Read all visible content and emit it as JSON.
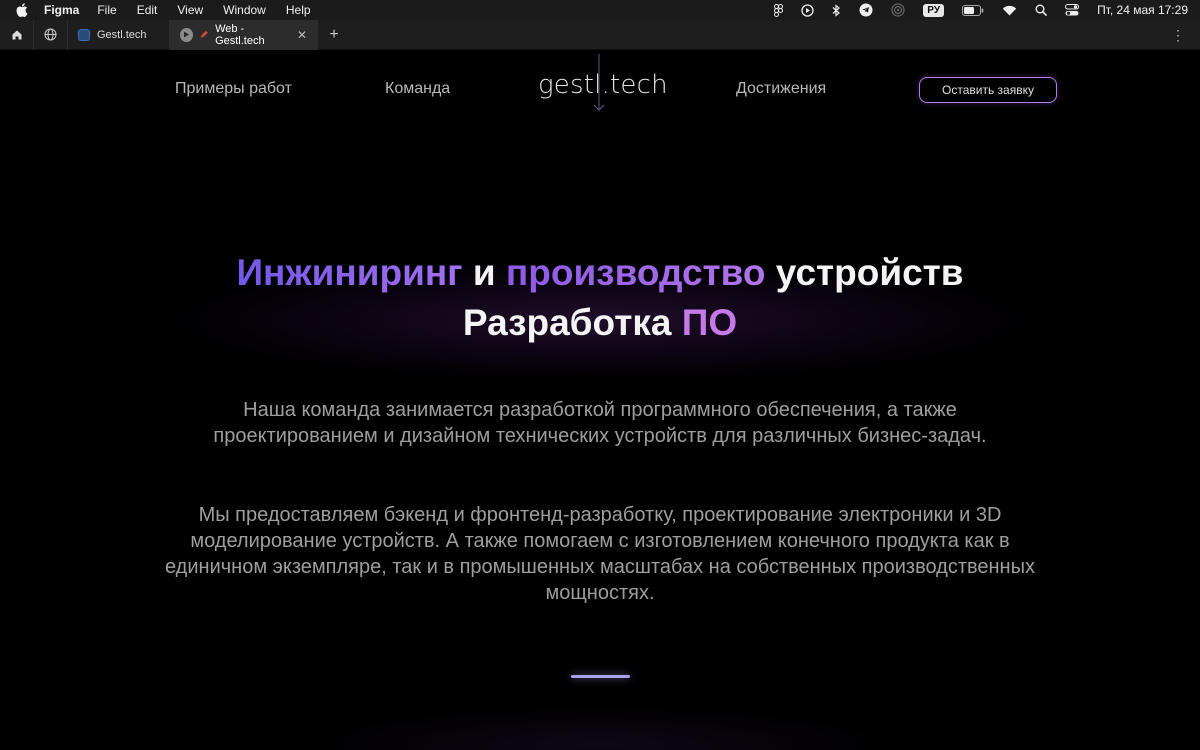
{
  "menubar": {
    "app_name": "Figma",
    "menus": [
      "File",
      "Edit",
      "View",
      "Window",
      "Help"
    ],
    "keyboard_layout": "РУ",
    "datetime": "Пт, 24 мая  17:29",
    "status_icons": [
      "figma-icon",
      "play-circle-icon",
      "bluetooth-icon",
      "telegram-icon",
      "airdrop-icon",
      "battery-icon",
      "wifi-icon",
      "search-icon",
      "control-center-icon"
    ]
  },
  "tabbar": {
    "tabs": [
      {
        "label": "Gestl.tech",
        "active": false
      },
      {
        "label": "Web - Gestl.tech",
        "active": true
      }
    ],
    "new_tab": "+",
    "more": "⋮"
  },
  "site": {
    "nav": {
      "works": "Примеры работ",
      "team": "Команда",
      "achievements": "Достижения",
      "cta": "Оставить заявку"
    },
    "logo": "gestl.tech",
    "headline": {
      "part1": "Инжиниринг",
      "part2": " и ",
      "part3": "производство",
      "part4": " устройств",
      "line2_a": "Разработка ",
      "line2_b": "ПО"
    },
    "paragraph1": "Наша команда занимается  разработкой программного обеспечения, а также проектированием и дизайном технических устройств для различных бизнес-задач.",
    "paragraph2": "Мы предоставляем бэкенд и фронтенд-разработку, проектирование электроники и 3D моделирование устройств. А также помогаем с изготовлением конечного продукта как в единичном экземпляре, так и в промышенных масштабах на собственных производственных мощностях."
  },
  "colors": {
    "accent_violet": "#8a5cf0",
    "accent_purple": "#9a62e8",
    "accent_pink": "#c67ae8",
    "cta_border": "#b57df0",
    "scroll_indicator": "#a9a1ea"
  }
}
